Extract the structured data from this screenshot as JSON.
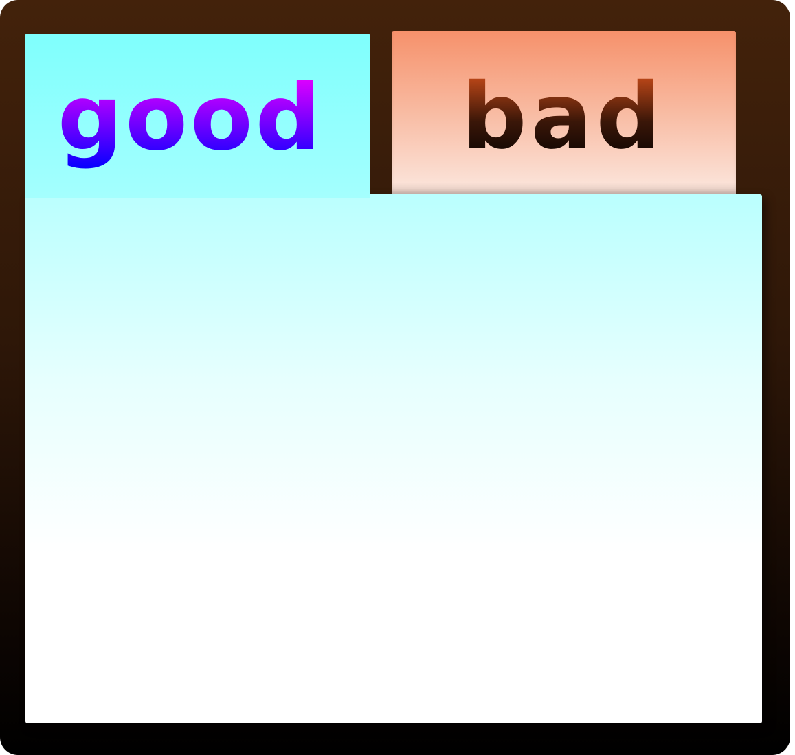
{
  "tabs": [
    {
      "id": "good",
      "label": "good",
      "selected": true,
      "colors": {
        "text_top": "#ff00ff",
        "text_bottom": "#0000ff",
        "bg_top": "#7ffffd",
        "bg_bottom": "#a4fffe"
      }
    },
    {
      "id": "bad",
      "label": "bad",
      "selected": false,
      "colors": {
        "text_top": "#e0541c",
        "text_bottom": "#000000",
        "bg_top": "#f6916b",
        "bg_bottom": "#fbe1d6"
      }
    }
  ],
  "frame": {
    "color_top": "#43220b",
    "color_bottom": "#000000"
  },
  "panel": {
    "color_top": "#bafffe",
    "color_bottom": "#ffffff"
  }
}
